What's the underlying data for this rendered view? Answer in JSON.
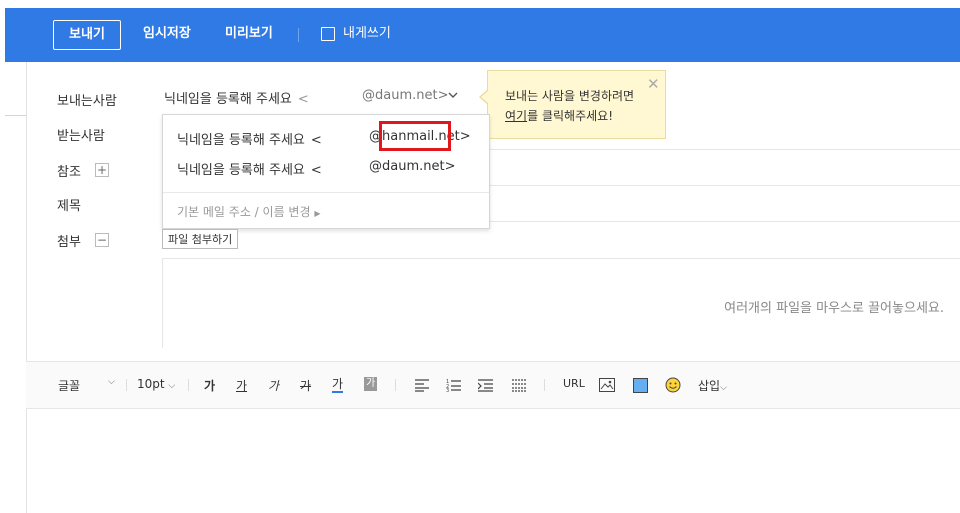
{
  "toolbar": {
    "send": "보내기",
    "draft": "임시저장",
    "preview": "미리보기",
    "to_me": "내게쓰기"
  },
  "labels": {
    "from": "보내는사람",
    "to": "받는사람",
    "cc": "참조",
    "subject": "제목",
    "attach": "첨부"
  },
  "sender": {
    "nickname": "닉네임을 등록해 주세요",
    "open": "<",
    "address": "@daum.net>"
  },
  "tooltip": {
    "line1": "보내는 사람을 변경하려면",
    "link": "여기",
    "line2_rest": "를 클릭해주세요!"
  },
  "dropdown": {
    "items": [
      {
        "nickname": "닉네임을 등록해 주세요",
        "open": "<",
        "address": "@hanmail.net>"
      },
      {
        "nickname": "닉네임을 등록해 주세요",
        "open": "<",
        "address": "@daum.net>"
      }
    ],
    "footer": "기본 메일 주소 / 이름 변경"
  },
  "attach": {
    "button": "파일 첨부하기",
    "dropzone_hint": "여러개의 파일을 마우스로 끌어놓으세요."
  },
  "editor": {
    "font": "글꼴",
    "size": "10pt",
    "bold": "가",
    "underline": "가",
    "italic": "가",
    "strike": "가",
    "color": "가",
    "bgcolor": "가",
    "url": "URL",
    "insert": "삽입"
  },
  "colors": {
    "brand": "#2f7ae5",
    "highlight": "#e0181c",
    "tooltip_bg": "#fff8d2"
  }
}
